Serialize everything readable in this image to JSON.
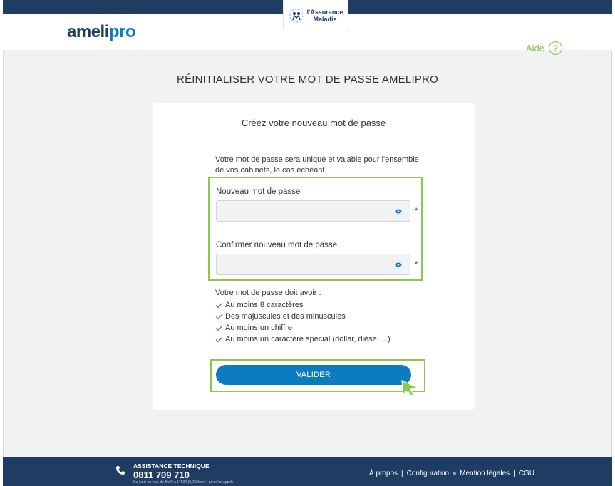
{
  "header": {
    "logo_main": "ameli",
    "logo_suffix": "pro",
    "badge_line1": "l'Assurance",
    "badge_line2": "Maladie",
    "help_label": "Aide",
    "help_symbol": "?"
  },
  "page_title": "RÉINITIALISER VOTRE MOT DE PASSE AMELIPRO",
  "card": {
    "title": "Créez votre nouveau mot de passe",
    "intro": "Votre mot de passe sera unique et valable pour l'ensemble de vos cabinets, le cas échéant.",
    "new_password_label": "Nouveau mot de passe",
    "new_password_value": "",
    "confirm_password_label": "Confirmer nouveau mot de passe",
    "confirm_password_value": "",
    "required_mark": "*",
    "rules_heading": "Votre mot de passe doit avoir :",
    "rules": [
      "Au moins 8 caractères",
      "Des majuscules et des minuscules",
      "Au moins un chiffre",
      "Au moins un caractère spécial (dollar, dièse, ...)"
    ],
    "submit_label": "VALIDER"
  },
  "footer": {
    "assistance_title": "ASSISTANCE TECHNIQUE",
    "assistance_number": "0811 709 710",
    "assistance_hours": "Du lundi au ven. de 8h30 à 17h30 (0,06€/min + prix d'un appel)",
    "links": [
      "À propos",
      "Configuration",
      "Mention légales",
      "CGU"
    ]
  },
  "colors": {
    "brand_navy": "#1f3c63",
    "brand_blue": "#0c7cc1",
    "accent_green": "#8cc84b",
    "page_bg": "#f1f2f2"
  },
  "icons": [
    "question-icon",
    "eye-icon",
    "check-icon",
    "phone-icon",
    "cursor-arrow-icon",
    "assurance-maladie-logo-icon"
  ]
}
